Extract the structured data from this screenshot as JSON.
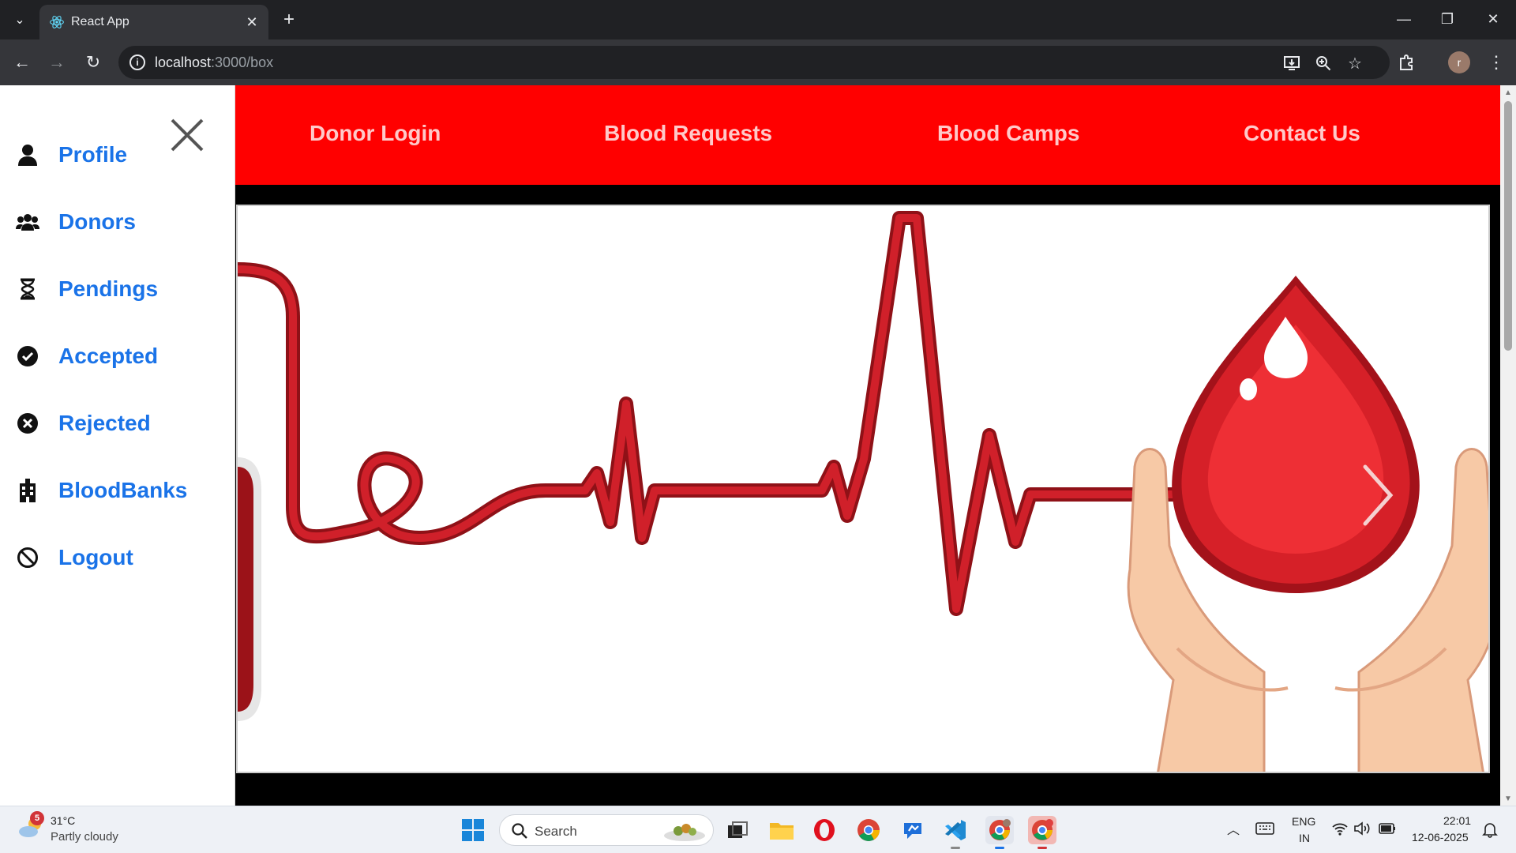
{
  "browser": {
    "tab_title": "React App",
    "url_host": "localhost",
    "url_rest": ":3000/box",
    "profile_initial": "r"
  },
  "sidebar": {
    "items": [
      {
        "label": "Profile",
        "icon": "user-icon"
      },
      {
        "label": "Donors",
        "icon": "users-icon"
      },
      {
        "label": "Pendings",
        "icon": "hourglass-icon"
      },
      {
        "label": "Accepted",
        "icon": "check-circle-icon"
      },
      {
        "label": "Rejected",
        "icon": "x-circle-icon"
      },
      {
        "label": "BloodBanks",
        "icon": "building-icon"
      },
      {
        "label": "Logout",
        "icon": "ban-icon"
      }
    ]
  },
  "topnav": {
    "links": [
      "Donor Login",
      "Blood Requests",
      "Blood Camps",
      "Contact Us"
    ]
  },
  "banner": {
    "image": "heartbeat-blood-drop-hands",
    "next_icon": "chevron-right-icon"
  },
  "taskbar": {
    "weather_badge": "5",
    "weather_temp": "31°C",
    "weather_desc": "Partly cloudy",
    "search_label": "Search",
    "language_top": "ENG",
    "language_bottom": "IN",
    "time": "22:01",
    "date": "12-06-2025"
  },
  "colors": {
    "nav_red": "#ff0000",
    "nav_link": "#ffc9c9",
    "sidebar_link": "#1a73e8",
    "blood_red": "#d0202a"
  }
}
